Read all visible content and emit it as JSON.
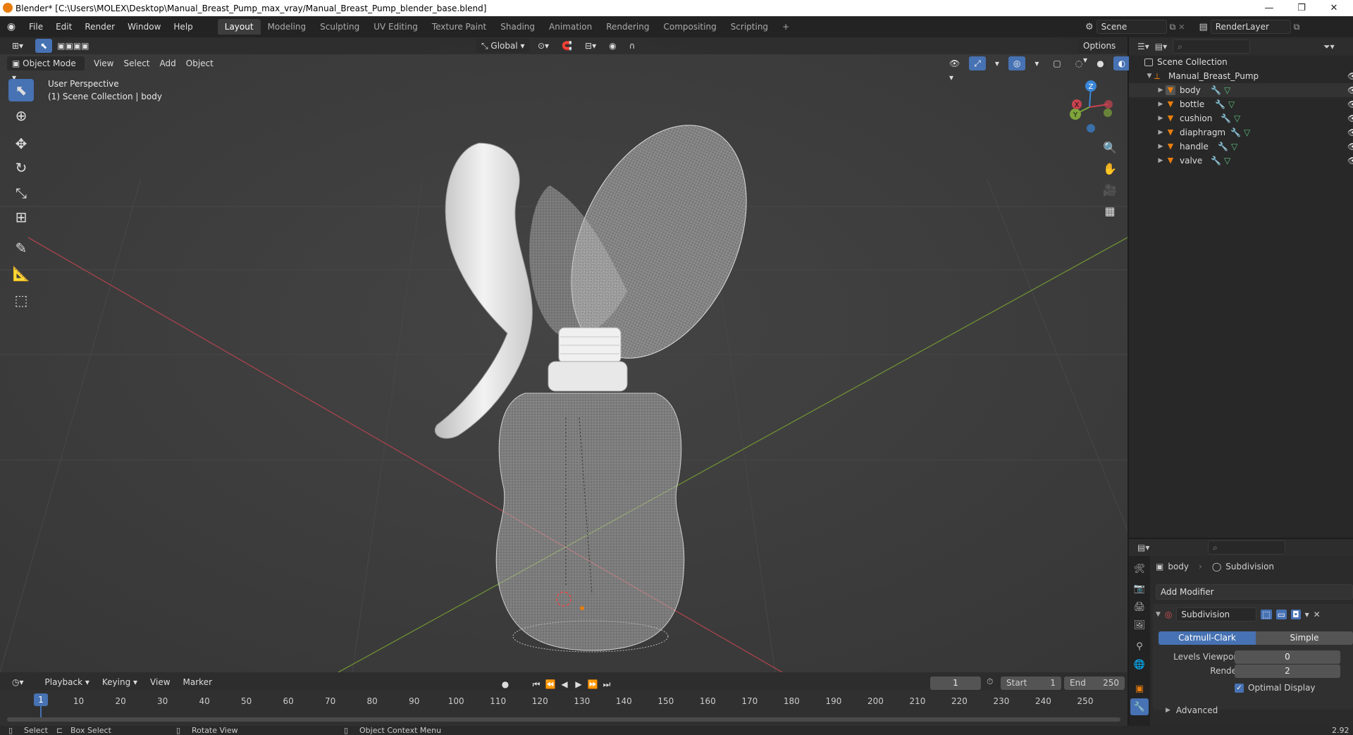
{
  "window": {
    "title": "Blender* [C:\\Users\\MOLEX\\Desktop\\Manual_Breast_Pump_max_vray/Manual_Breast_Pump_blender_base.blend]",
    "minimize": "—",
    "restore": "❐",
    "close": "✕"
  },
  "menu": {
    "items": [
      "File",
      "Edit",
      "Render",
      "Window",
      "Help"
    ],
    "workspaces": [
      "Layout",
      "Modeling",
      "Sculpting",
      "UV Editing",
      "Texture Paint",
      "Shading",
      "Animation",
      "Rendering",
      "Compositing",
      "Scripting"
    ],
    "add_workspace": "+",
    "scene": "Scene",
    "render_layer": "RenderLayer"
  },
  "viewport": {
    "transform_orientation": "Global",
    "options": "Options",
    "mode": "Object Mode",
    "header_menus": [
      "View",
      "Select",
      "Add",
      "Object"
    ],
    "perspective": "User Perspective",
    "collection_info": "(1) Scene Collection | body",
    "gizmo": {
      "z": "Z",
      "y": "Y",
      "x": "X"
    }
  },
  "outliner": {
    "root": "Scene Collection",
    "collection": "Manual_Breast_Pump",
    "objects": [
      "body",
      "bottle",
      "cushion",
      "diaphragm",
      "handle",
      "valve"
    ],
    "selected": "body"
  },
  "properties": {
    "object": "body",
    "modifier_context": "Subdivision",
    "add_modifier": "Add Modifier",
    "modifier_name": "Subdivision",
    "types": [
      "Catmull-Clark",
      "Simple"
    ],
    "active_type": "Catmull-Clark",
    "levels_viewport_label": "Levels Viewport",
    "levels_viewport": "0",
    "render_label": "Render",
    "render": "2",
    "optimal_display": "Optimal Display",
    "optimal_display_checked": true,
    "advanced": "Advanced"
  },
  "timeline": {
    "menus": [
      "Playback",
      "Keying",
      "View",
      "Marker"
    ],
    "current_frame": "1",
    "start_label": "Start",
    "start": "1",
    "end_label": "End",
    "end": "250",
    "ticks": [
      "1",
      "10",
      "20",
      "30",
      "40",
      "50",
      "60",
      "70",
      "80",
      "90",
      "100",
      "110",
      "120",
      "130",
      "140",
      "150",
      "160",
      "170",
      "180",
      "190",
      "200",
      "210",
      "220",
      "230",
      "240",
      "250"
    ]
  },
  "statusbar": {
    "select": "Select",
    "box_select": "Box Select",
    "rotate_view": "Rotate View",
    "context_menu": "Object Context Menu",
    "version": "2.92"
  },
  "colors": {
    "accent": "#4772b3",
    "object_orange": "#e87d0d",
    "x_axis": "#c8434f",
    "y_axis": "#7ea43a",
    "z_axis": "#3a86d8"
  }
}
